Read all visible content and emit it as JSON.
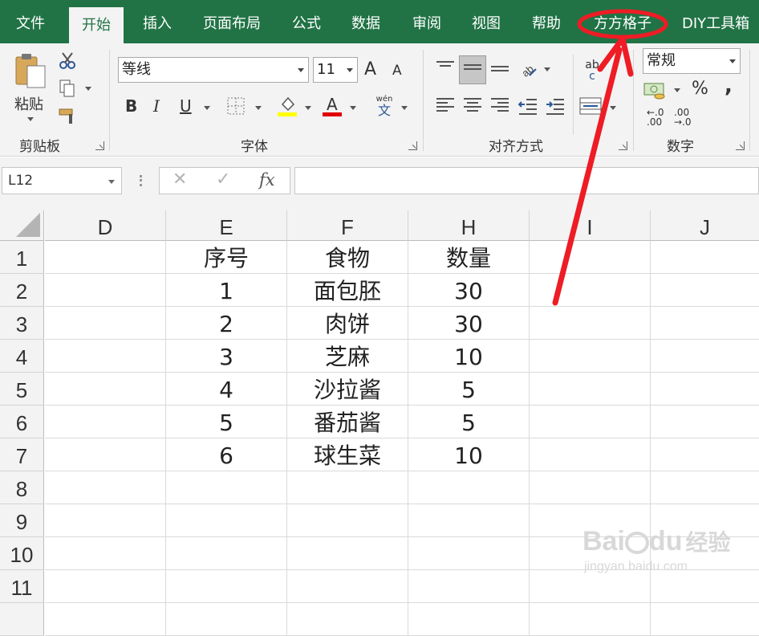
{
  "tabs": [
    {
      "label": "文件",
      "active": false
    },
    {
      "label": "开始",
      "active": true
    },
    {
      "label": "插入",
      "active": false
    },
    {
      "label": "页面布局",
      "active": false
    },
    {
      "label": "公式",
      "active": false
    },
    {
      "label": "数据",
      "active": false
    },
    {
      "label": "审阅",
      "active": false
    },
    {
      "label": "视图",
      "active": false
    },
    {
      "label": "帮助",
      "active": false
    },
    {
      "label": "方方格子",
      "active": false
    },
    {
      "label": "DIY工具箱",
      "active": false
    }
  ],
  "clipboard": {
    "paste_label": "粘贴",
    "group_label": "剪贴板"
  },
  "font": {
    "name": "等线",
    "size": "11",
    "grow_label": "A",
    "shrink_label": "A",
    "bold_label": "B",
    "italic_label": "I",
    "underline_label": "U",
    "color_label": "A",
    "pinyin_top": "wén",
    "pinyin_bottom": "文",
    "group_label": "字体",
    "highlight_color": "#ffff00",
    "font_color": "#e00000"
  },
  "alignment": {
    "group_label": "对齐方式",
    "wrap_label_top": "ab",
    "wrap_label_bottom": "c"
  },
  "number": {
    "format": "常规",
    "percent_label": "%",
    "comma_label": ",",
    "increase_decimal_top": "←.0",
    "increase_decimal_bottom": ".00",
    "decrease_decimal_top": ".00",
    "decrease_decimal_bottom": "→.0",
    "group_label": "数字"
  },
  "formula_bar": {
    "name_box": "L12",
    "cancel_label": "✕",
    "enter_label": "✓",
    "fx_label": "fx",
    "value": ""
  },
  "columns": [
    "D",
    "E",
    "F",
    "H",
    "I",
    "J"
  ],
  "rows": [
    "1",
    "2",
    "3",
    "4",
    "5",
    "6",
    "7",
    "8",
    "9",
    "10",
    "11"
  ],
  "sheet": {
    "headers": [
      "序号",
      "食物",
      "数量"
    ],
    "data": [
      [
        "1",
        "面包胚",
        "30"
      ],
      [
        "2",
        "肉饼",
        "30"
      ],
      [
        "3",
        "芝麻",
        "10"
      ],
      [
        "4",
        "沙拉酱",
        "5"
      ],
      [
        "5",
        "番茄酱",
        "5"
      ],
      [
        "6",
        "球生菜",
        "10"
      ]
    ]
  },
  "annotation": {
    "color": "#ee1c25",
    "target_tab": "方方格子"
  },
  "watermark": {
    "brand": "Bai",
    "brand_suffix": "du",
    "brand_cn": "经验",
    "url": "jingyan.baidu.com"
  },
  "colors": {
    "ribbon_green": "#217346",
    "ribbon_bg": "#f3f3f3"
  }
}
